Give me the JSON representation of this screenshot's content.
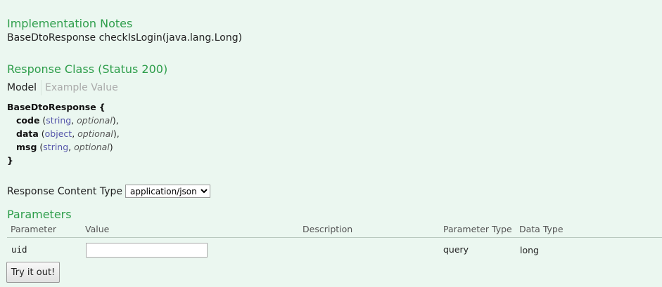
{
  "implementation": {
    "title": "Implementation Notes",
    "text": "BaseDtoResponse checkIsLogin(java.lang.Long)"
  },
  "response_class": {
    "title": "Response Class (Status 200)",
    "tabs": [
      {
        "label": "Model",
        "active": true
      },
      {
        "label": "Example Value",
        "active": false
      }
    ],
    "model": {
      "name": "BaseDtoResponse",
      "open": "{",
      "close": "}",
      "fields": [
        {
          "name": "code",
          "type": "string",
          "opt": "optional",
          "suffix": "),"
        },
        {
          "name": "data",
          "type": "object",
          "opt": "optional",
          "suffix": "),"
        },
        {
          "name": "msg",
          "type": "string",
          "opt": "optional",
          "suffix": ")"
        }
      ]
    }
  },
  "response_content_type": {
    "label": "Response Content Type",
    "selected": "application/json"
  },
  "parameters": {
    "title": "Parameters",
    "headers": [
      "Parameter",
      "Value",
      "Description",
      "Parameter Type",
      "Data Type"
    ],
    "rows": [
      {
        "name": "uid",
        "value": "",
        "description": "",
        "param_type": "query",
        "data_type": "long"
      }
    ]
  },
  "try_button": {
    "label": "Try it out!"
  },
  "colors": {
    "accent": "#2e9e4b",
    "background": "#ebf7f0"
  }
}
